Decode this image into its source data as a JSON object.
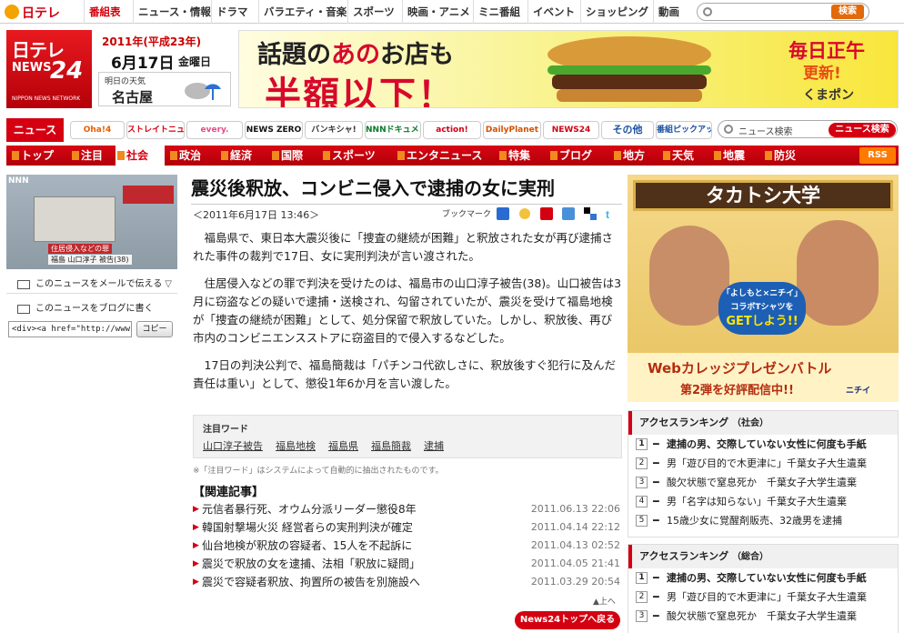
{
  "top_nav": {
    "logo": "日テレ",
    "items": [
      {
        "label": "番組表",
        "active": true
      },
      {
        "label": "ニュース・情報"
      },
      {
        "label": "ドラマ"
      },
      {
        "label": "バラエティ・音楽"
      },
      {
        "label": "スポーツ"
      },
      {
        "label": "映画・アニメ"
      },
      {
        "label": "ミニ番組"
      },
      {
        "label": "イベント"
      },
      {
        "label": "ショッピング"
      },
      {
        "label": "動画"
      }
    ],
    "search_button": "検索"
  },
  "header": {
    "logo": {
      "line1": "日テレ",
      "line2": "NEWS",
      "line3": "24",
      "line4": "NIPPON NEWS NETWORK"
    },
    "date_era": "2011年(平成23年)",
    "date_main": "6月17日",
    "date_dow": "金曜日",
    "weather_label": "明日の天気",
    "weather_city": "名古屋",
    "banner": {
      "text1_a": "話題の",
      "text1_b": "あの",
      "text1_c": "お店も",
      "text2": "半額以下！",
      "right1": "毎日正午",
      "right2": "更新!",
      "right3": "くまポン"
    }
  },
  "program_bar": {
    "news_tab": "ニュース",
    "items": [
      "Oha!4",
      "ストレイトニュース",
      "every.",
      "NEWS ZERO",
      "バンキシャ!",
      "NNNドキュメント",
      "action!",
      "DailyPlanet",
      "NEWS24",
      "その他",
      "番組ピックアップ"
    ],
    "search_placeholder": "ニュース検索",
    "search_button": "ニュース検索"
  },
  "categories": {
    "items": [
      {
        "label": "トップ"
      },
      {
        "label": "注目"
      },
      {
        "label": "社会",
        "active": true
      },
      {
        "label": "政治"
      },
      {
        "label": "経済"
      },
      {
        "label": "国際"
      },
      {
        "label": "スポーツ"
      },
      {
        "label": "エンタニュース"
      },
      {
        "label": "特集"
      },
      {
        "label": "ブログ"
      },
      {
        "label": "地方"
      },
      {
        "label": "天気"
      },
      {
        "label": "地震"
      },
      {
        "label": "防災"
      }
    ],
    "rss": "RSS"
  },
  "left_col": {
    "video": {
      "brand": "NNN",
      "caption1": "住居侵入などの罪",
      "caption2": "福島 山口淳子 被告(38)"
    },
    "mail_link": "このニュースをメールで伝える",
    "blog_link": "このニュースをブログに書く",
    "embed_code": "<div><a href=\"http://www.news",
    "copy_button": "コピー"
  },
  "article": {
    "title": "震災後釈放、コンビニ侵入で逮捕の女に実刑",
    "date": "＜2011年6月17日 13:46＞",
    "bookmark_label": "ブックマーク",
    "paragraphs": [
      "福島県で、東日本大震災後に「捜査の継続が困難」と釈放された女が再び逮捕された事件の裁判で17日、女に実刑判決が言い渡された。",
      "住居侵入などの罪で判決を受けたのは、福島市の山口淳子被告(38)。山口被告は3月に窃盗などの疑いで逮捕・送検され、勾留されていたが、震災を受けて福島地検が「捜査の継続が困難」として、処分保留で釈放していた。しかし、釈放後、再び市内のコンビニエンスストアに窃盗目的で侵入するなどした。",
      "17日の判決公判で、福島簡裁は「パチンコ代欲しさに、釈放後すぐ犯行に及んだ責任は重い」として、懲役1年6か月を言い渡した。"
    ],
    "keywords_heading": "注目ワード",
    "keywords": [
      "山口淳子被告",
      "福島地検",
      "福島県",
      "福島簡裁",
      "逮捕"
    ],
    "keywords_note": "※「注目ワード」はシステムによって自動的に抽出されたものです。",
    "related_heading": "【関連記事】",
    "related": [
      {
        "title": "元信者暴行死、オウム分派リーダー懲役8年",
        "date": "2011.06.13 22:06"
      },
      {
        "title": "韓国射撃場火災 経営者らの実刑判決が確定",
        "date": "2011.04.14 22:12"
      },
      {
        "title": "仙台地検が釈放の容疑者、15人を不起訴に",
        "date": "2011.04.13 02:52"
      },
      {
        "title": "震災で釈放の女を逮捕、法相「釈放に疑問」",
        "date": "2011.04.05 21:41"
      },
      {
        "title": "震災で容疑者釈放、拘置所の被告を別施設へ",
        "date": "2011.03.29 20:54"
      }
    ],
    "to_top": "▲上へ",
    "back_button": "News24トップへ戻る"
  },
  "right_col": {
    "ad": {
      "title": "タカトシ大学",
      "shirt1": "「よしもと×ニチイ」",
      "shirt2": "コラボTシャツを",
      "shirt3": "GETしよう!!",
      "bottom1": "Webカレッジプレゼンバトル",
      "bottom2": "第2弾を好評配信中!!",
      "brand": "ニチイ"
    },
    "ranking_social": {
      "title": "アクセスランキング",
      "sub": "（社会）",
      "items": [
        "逮捕の男、交際していない女性に何度も手紙",
        "男「遊び目的で木更津に」千葉女子大生遺棄",
        "酸欠状態で窒息死か　千葉女子大学生遺棄",
        "男「名字は知らない」千葉女子大生遺棄",
        "15歳少女に覚醒剤販売、32歳男を逮捕"
      ]
    },
    "ranking_all": {
      "title": "アクセスランキング",
      "sub": "（総合）",
      "items": [
        "逮捕の男、交際していない女性に何度も手紙",
        "男「遊び目的で木更津に」千葉女子大生遺棄",
        "酸欠状態で窒息死か　千葉女子大学生遺棄"
      ]
    }
  },
  "colors": {
    "brand_red": "#d40012",
    "accent_orange": "#f08a1c"
  }
}
